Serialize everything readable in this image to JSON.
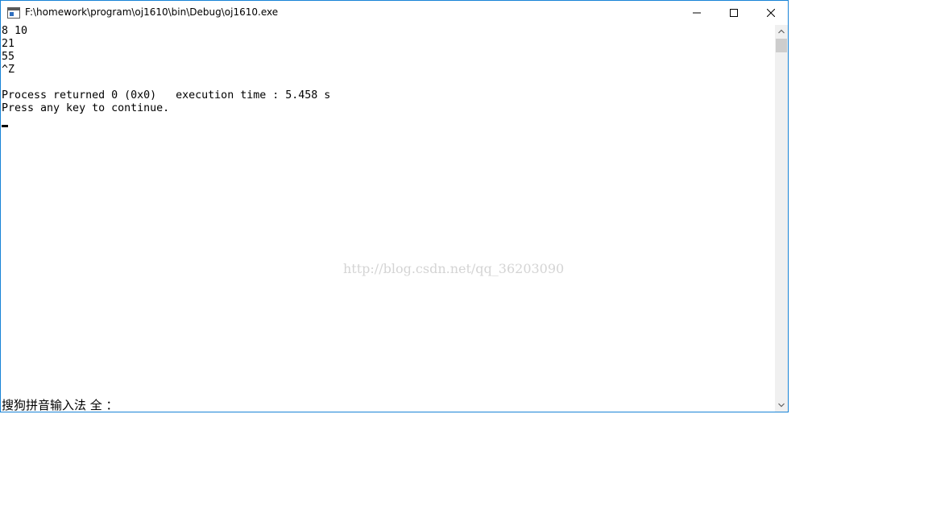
{
  "window": {
    "title": "F:\\homework\\program\\oj1610\\bin\\Debug\\oj1610.exe",
    "border_color": "#1883d7",
    "icon": "console-app-icon"
  },
  "controls": {
    "minimize_icon": "minimize-icon",
    "maximize_icon": "maximize-icon",
    "close_icon": "close-icon"
  },
  "console": {
    "lines": [
      "8 10",
      "21",
      "55",
      "^Z",
      "",
      "Process returned 0 (0x0)   execution time : 5.458 s",
      "Press any key to continue."
    ],
    "ime_status": "搜狗拼音输入法 全 ："
  },
  "watermark": "http://blog.csdn.net/qq_36203090"
}
